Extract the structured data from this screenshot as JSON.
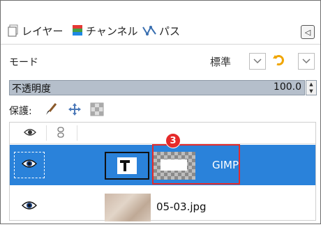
{
  "tabs": [
    {
      "label": "レイヤー",
      "icon": "layers-icon"
    },
    {
      "label": "チャンネル",
      "icon": "channels-icon"
    },
    {
      "label": "パス",
      "icon": "paths-icon"
    }
  ],
  "mode": {
    "label": "モード",
    "value": "標準"
  },
  "opacity": {
    "label": "不透明度",
    "value": "100.0"
  },
  "protect": {
    "label": "保護:"
  },
  "layers": [
    {
      "name": "GIMP",
      "type": "text-layer",
      "selected": true,
      "visible": true
    },
    {
      "name": "05-03.jpg",
      "type": "image-layer",
      "selected": false,
      "visible": true
    }
  ],
  "annotation": {
    "number": "3",
    "color": "#e52a2a"
  },
  "colors": {
    "selection": "#2a82da",
    "opacity_bar": "#b5bfcb"
  }
}
